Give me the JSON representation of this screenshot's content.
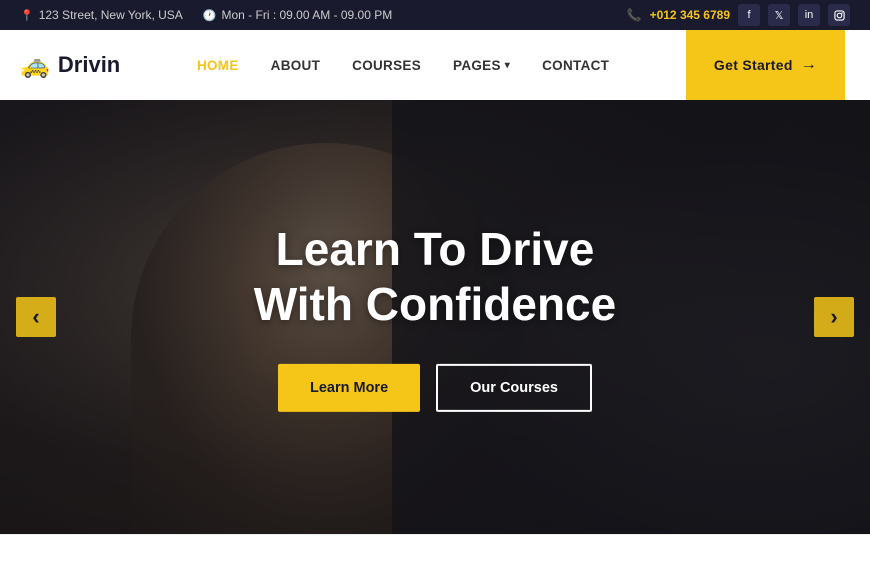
{
  "topbar": {
    "address": "123 Street, New York, USA",
    "hours": "Mon - Fri : 09.00 AM - 09.00 PM",
    "phone": "+012 345 6789",
    "address_icon": "📍",
    "clock_icon": "🕐",
    "phone_icon": "📞",
    "socials": [
      {
        "name": "facebook",
        "symbol": "f"
      },
      {
        "name": "twitter",
        "symbol": "t"
      },
      {
        "name": "linkedin",
        "symbol": "in"
      },
      {
        "name": "instagram",
        "symbol": "ig"
      }
    ]
  },
  "header": {
    "logo_text": "Drivin",
    "logo_icon": "🚕",
    "nav_items": [
      {
        "label": "HOME",
        "active": true
      },
      {
        "label": "ABOUT",
        "active": false
      },
      {
        "label": "COURSES",
        "active": false
      },
      {
        "label": "PAGES",
        "active": false,
        "has_dropdown": true
      },
      {
        "label": "CONTACT",
        "active": false
      }
    ],
    "cta_label": "Get Started",
    "cta_arrow": "→"
  },
  "hero": {
    "title_line1": "Learn To Drive",
    "title_line2": "With Confidence",
    "btn_primary": "Learn More",
    "btn_secondary": "Our Courses",
    "arrow_left": "‹",
    "arrow_right": "›"
  }
}
